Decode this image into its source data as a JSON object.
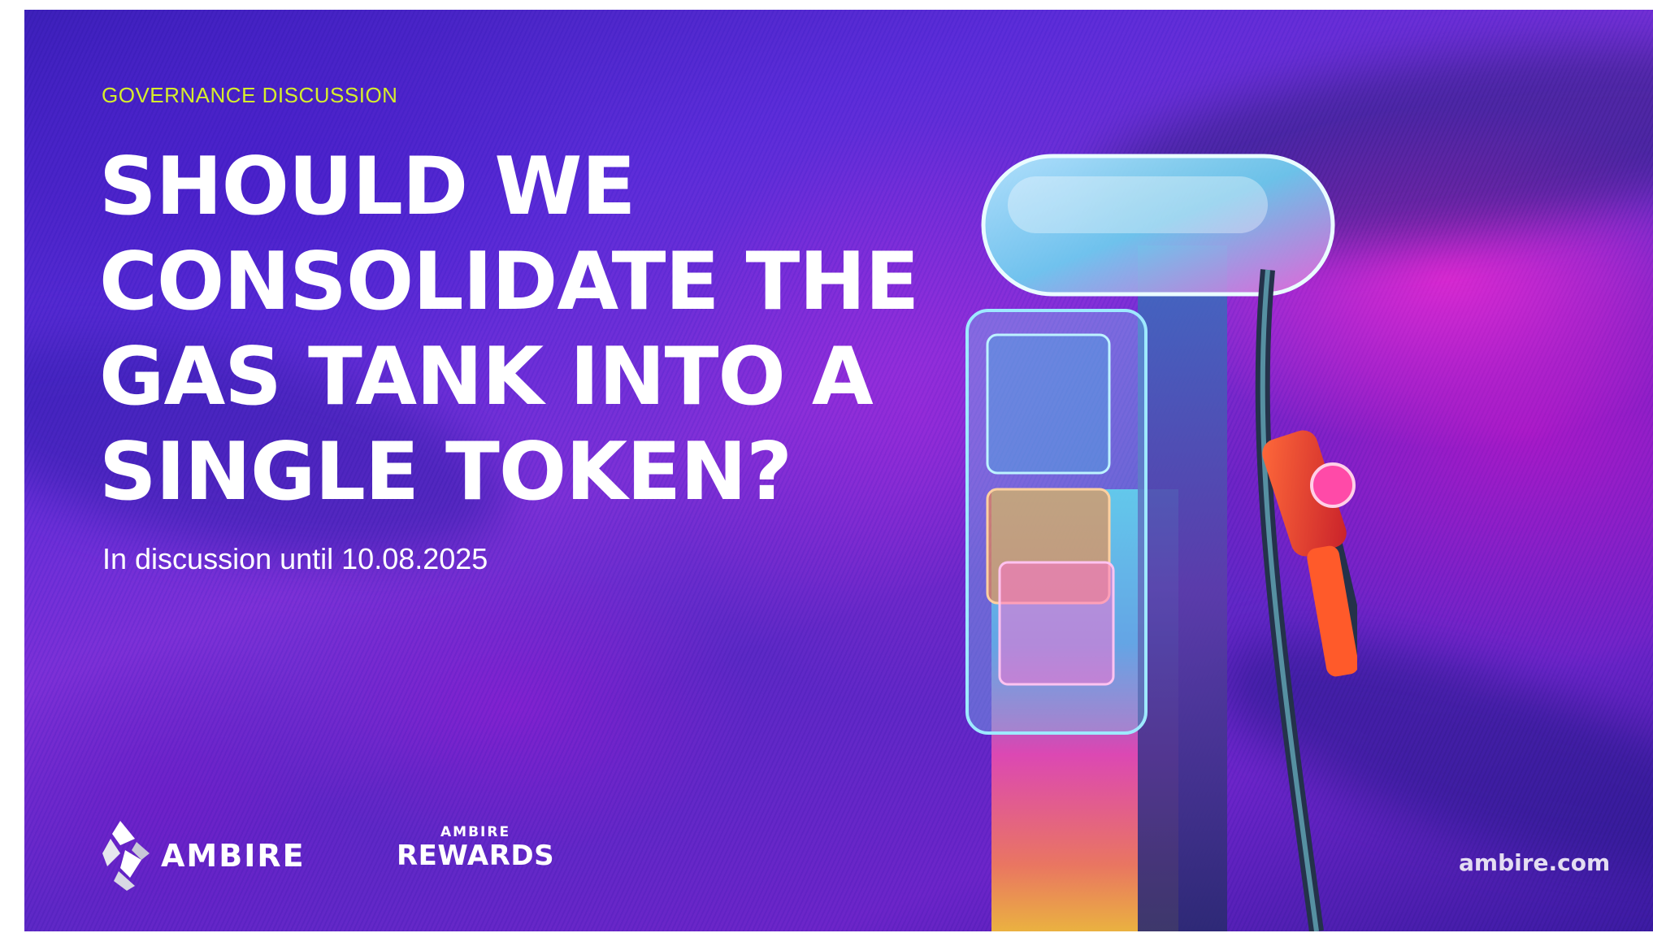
{
  "banner": {
    "eyebrow": "GOVERNANCE DISCUSSION",
    "headline_lines": [
      "SHOULD WE",
      "CONSOLIDATE THE",
      "GAS TANK INTO A",
      "SINGLE TOKEN?"
    ],
    "subtitle": "In discussion until 10.08.2025",
    "brand": "AMBIRE",
    "rewards_top": "AMBIRE",
    "rewards_bottom": "REWARDS",
    "website": "ambire.com"
  },
  "colors": {
    "eyebrow": "#d6ee2c",
    "headline": "#ffffff",
    "background_primary": "#5a2bd8",
    "background_accent": "#e828d2"
  },
  "icons": {
    "brand_logo": "ambire-logo-icon",
    "illustration": "gas-pump-illustration"
  }
}
